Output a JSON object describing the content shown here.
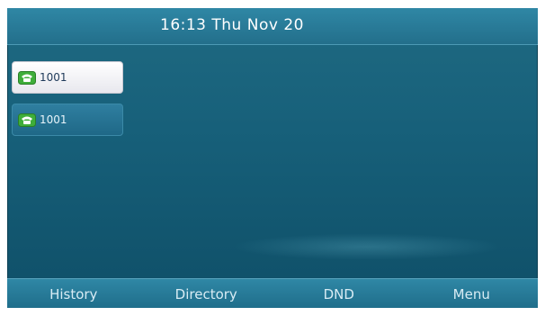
{
  "status_bar": {
    "datetime": "16:13 Thu Nov 20"
  },
  "line_keys": [
    {
      "label": "1001",
      "icon": "phone-registered-icon",
      "state": "selected"
    },
    {
      "label": "1001",
      "icon": "phone-registered-icon",
      "state": "normal"
    }
  ],
  "softkeys": {
    "history": "History",
    "directory": "Directory",
    "dnd": "DND",
    "menu": "Menu"
  },
  "colors": {
    "screen_bg": "#17607a",
    "bar_bg": "#2f87a5",
    "icon_green": "#3fae3a"
  }
}
